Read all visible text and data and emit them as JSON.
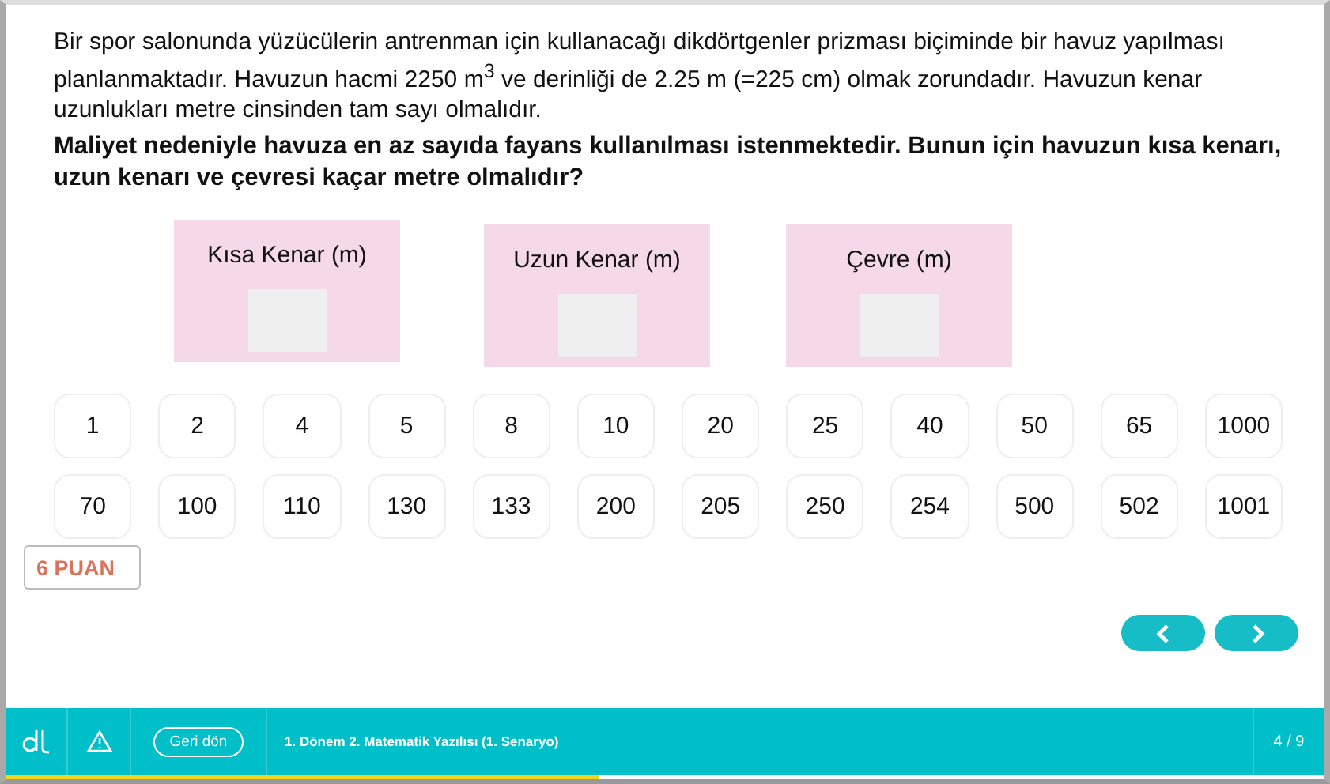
{
  "question": {
    "intro": "Bir spor salonunda yüzücülerin antrenman için kullanacağı dikdörtgenler prizması biçiminde bir havuz yapılması planlanmaktadır. Havuzun hacmi 2250 m$^{3}$ ve derinliği de 2.25 m (=225 cm) olmak zorundadır. Havuzun kenar uzunlukları metre cinsinden tam sayı olmalıdır.",
    "prompt": "Maliyet nedeniyle havuza en az sayıda fayans kullanılması istenmektedir. Bunun için havuzun kısa kenarı, uzun kenarı ve çevresi kaçar metre olmalıdır?"
  },
  "drop_zones": [
    {
      "label": "Kısa Kenar (m)"
    },
    {
      "label": "Uzun Kenar (m)"
    },
    {
      "label": "Çevre (m)"
    }
  ],
  "answer_rows": [
    [
      "1",
      "2",
      "4",
      "5",
      "8",
      "10",
      "20",
      "25",
      "40",
      "50",
      "65",
      "1000"
    ],
    [
      "70",
      "100",
      "110",
      "130",
      "133",
      "200",
      "205",
      "250",
      "254",
      "500",
      "502",
      "1001"
    ]
  ],
  "score": "6 PUAN",
  "footer": {
    "back_button": "Geri dön",
    "title": "1. Dönem 2. Matematik Yazılısı (1. Senaryo)",
    "page": "4 / 9",
    "progress": {
      "level": 0.45
    }
  }
}
